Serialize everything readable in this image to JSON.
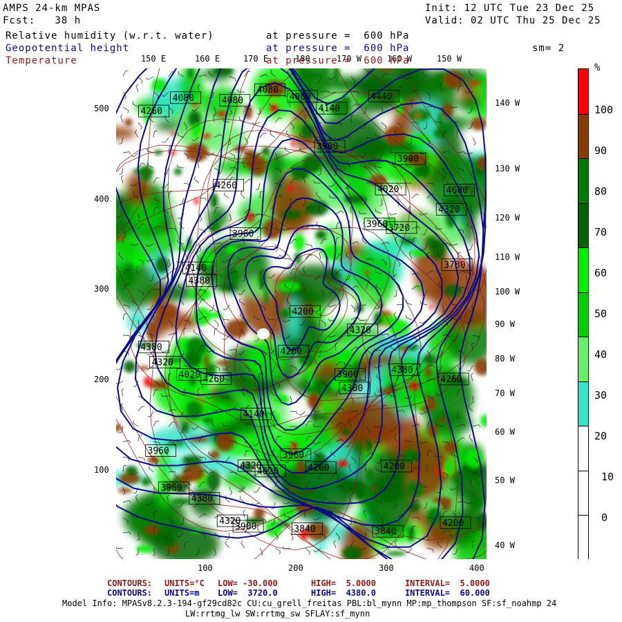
{
  "header": {
    "model": "AMPS 24-km MPAS",
    "fcst": "Fcst:   38 h",
    "init": "Init: 12 UTC Tue 23 Dec 25",
    "valid": "Valid: 02 UTC Thu 25 Dec 25",
    "smooth": "sm= 2",
    "fields": [
      {
        "name": "Relative humidity (w.r.t. water)",
        "level": "at pressure =  600 hPa",
        "color": "#000000"
      },
      {
        "name": "Geopotential height",
        "level": "at pressure =  600 hPa",
        "color": "#0a0a8c"
      },
      {
        "name": "Temperature",
        "level": "at pressure =  600 hPa",
        "color": "#8b1a1a"
      }
    ]
  },
  "axes": {
    "x_ticks": [
      "100",
      "200",
      "300",
      "400"
    ],
    "y_ticks": [
      "500",
      "400",
      "300",
      "200",
      "100"
    ],
    "lon_top": [
      "150 E",
      "160 E",
      "170 E",
      "180",
      "170 W",
      "160 W",
      "150 W"
    ],
    "lon_right": [
      "140 W",
      "130 W",
      "120 W",
      "110 W",
      "100 W",
      "90 W",
      "80 W",
      "70 W",
      "60 W",
      "50 W",
      "40 W"
    ]
  },
  "colorbar": {
    "unit": "%",
    "labels": [
      "100",
      "90",
      "80",
      "70",
      "60",
      "50",
      "40",
      "30",
      "20",
      "10",
      "0"
    ],
    "bins": [
      {
        "from": 100,
        "color": "#ff0000"
      },
      {
        "from": 90,
        "color": "#8b3a00"
      },
      {
        "from": 80,
        "color": "#007a00"
      },
      {
        "from": 70,
        "color": "#006400"
      },
      {
        "from": 60,
        "color": "#00ee00"
      },
      {
        "from": 50,
        "color": "#00d000"
      },
      {
        "from": 40,
        "color": "#66ee66"
      },
      {
        "from": 30,
        "color": "#33e6c8"
      },
      {
        "from": 20,
        "color": "#ffffff"
      },
      {
        "from": 10,
        "color": "#ffffff"
      },
      {
        "from": 0,
        "color": "#ffffff"
      }
    ]
  },
  "height_labels": [
    "4320",
    "4380",
    "4200",
    "4260",
    "4140",
    "4080",
    "4020",
    "3960",
    "3900",
    "3840",
    "3780",
    "3720",
    "4320",
    "3960",
    "3900",
    "4080",
    "4200",
    "4260",
    "4380",
    "4440",
    "4020",
    "4140",
    "4080",
    "3900",
    "3960",
    "4200",
    "4260",
    "4320",
    "4380",
    "4320",
    "4260",
    "4200",
    "4140",
    "4080",
    "4020",
    "4380",
    "3960",
    "3900",
    "3840",
    "4080",
    "4260",
    "3960",
    "4380",
    "4320"
  ],
  "footer": {
    "temp": {
      "contours": "CONTOURS:",
      "units": "UNITS=°C",
      "low": "LOW= -30.000",
      "high": "HIGH=  5.0000",
      "interval": "INTERVAL=  5.0000",
      "color": "#8b1a1a"
    },
    "height": {
      "contours": "CONTOURS:",
      "units": "UNITS=m",
      "low": "LOW=  3720.0",
      "high": "HIGH=  4380.0",
      "interval": "INTERVAL=  60.000",
      "color": "#0a0a8c"
    },
    "model_info": "Model Info: MPASv8.2.3-194-gf29cd82c CU:cu_grell_freitas PBL:bl_mynn MP:mp_thompson SF:sf_noahmp 24",
    "model_info2": "LW:rrtmg_lw SW:rrtmg_sw SFLAY:sf_mynn"
  }
}
